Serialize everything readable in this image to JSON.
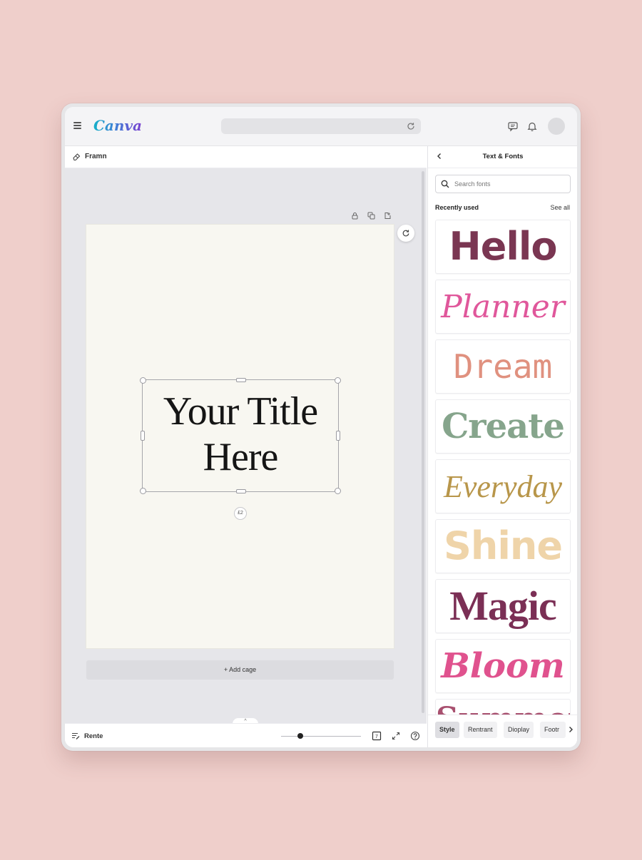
{
  "app": {
    "logo": "Canva"
  },
  "topbar": {
    "icons": [
      "menu-icon",
      "reload-icon",
      "comment-icon",
      "bell-icon",
      "avatar"
    ]
  },
  "editor": {
    "subbar_label": "Framn",
    "page_title_text_line1": "Your Title",
    "page_title_text_line2": "Here",
    "rotate_label": "£2",
    "add_page_label": "+ Add cage",
    "notes_label": "Rente",
    "collapse_label": "^"
  },
  "panel": {
    "title": "Text & Fonts",
    "search_placeholder": "Search fonts",
    "recently_used_label": "Recently used",
    "see_all_label": "See all",
    "fonts": [
      {
        "label": "Hello",
        "color": "#7a3652"
      },
      {
        "label": "Planner",
        "color": "#e0579b"
      },
      {
        "label": "Dream",
        "color": "#e0917f"
      },
      {
        "label": "Create",
        "color": "#86a58c"
      },
      {
        "label": "Everyday",
        "color": "#b8964a"
      },
      {
        "label": "Shine",
        "color": "#efd4a9"
      },
      {
        "label": "Magic",
        "color": "#7b2f55"
      },
      {
        "label": "Bloom",
        "color": "#e0528e"
      },
      {
        "label": "Summer",
        "color": "#a8506f"
      }
    ],
    "chips": [
      "Style",
      "Rentrant",
      "Dioplay",
      "Footr"
    ]
  }
}
